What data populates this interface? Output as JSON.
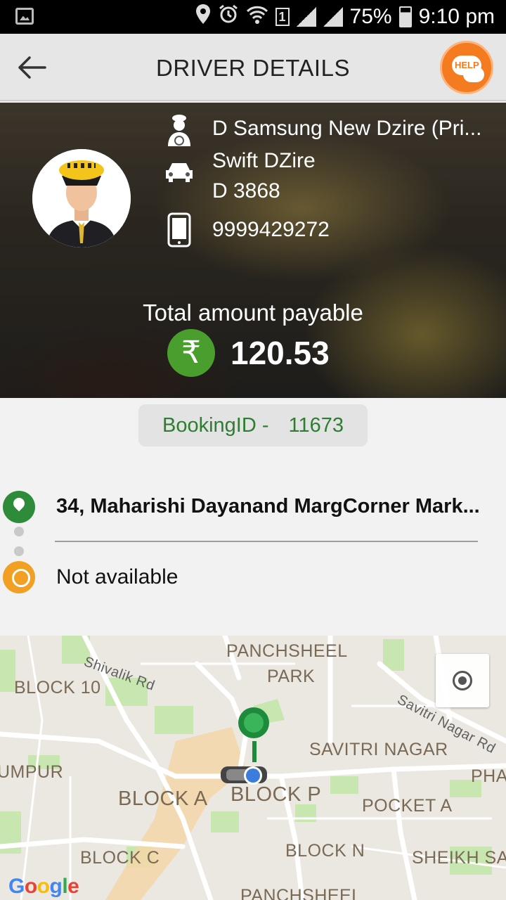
{
  "status_bar": {
    "battery": "75%",
    "time": "9:10 pm",
    "sim_slot": "1"
  },
  "app_bar": {
    "title": "DRIVER DETAILS",
    "help_label": "HELP"
  },
  "driver": {
    "name": "D Samsung New Dzire (Pri...",
    "car_model": "Swift DZire",
    "car_number": "D 3868",
    "phone": "9999429272"
  },
  "payment": {
    "label": "Total amount payable",
    "currency_symbol": "₹",
    "amount": "120.53"
  },
  "booking": {
    "label": "BookingID -",
    "id": "11673"
  },
  "trip": {
    "pickup": "34, Maharishi Dayanand MargCorner Mark...",
    "drop": "Not available"
  },
  "map": {
    "labels": {
      "panchsheel_park_1": "PANCHSHEEL",
      "panchsheel_park_2": "PARK",
      "shivalik_rd": "Shivalik Rd",
      "block_10": "BLOCK 10",
      "savitri_nagar_rd": "Savitri Nagar Rd",
      "savitri_nagar": "SAVITRI NAGAR",
      "umpur": "UMPUR",
      "pha": "PHA",
      "block_a": "BLOCK A",
      "block_p": "BLOCK P",
      "pocket_a": "POCKET A",
      "block_c": "BLOCK C",
      "block_n": "BLOCK N",
      "sheikh_sa": "SHEIKH SA",
      "panchsheel_bottom": "PANCHSHEEL"
    },
    "attribution": "Google"
  },
  "colors": {
    "accent_green": "#2e7d32",
    "help_orange": "#f47b1f",
    "pin_orange": "#f2a024"
  }
}
